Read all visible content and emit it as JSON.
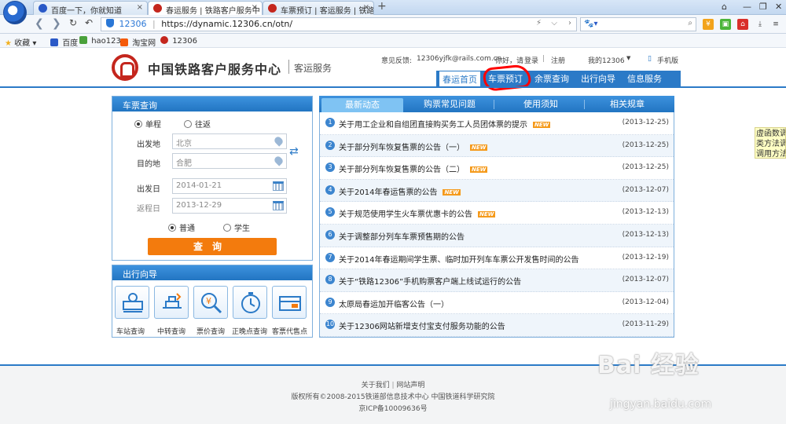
{
  "browser": {
    "tabs": [
      {
        "label": "百度一下，你就知道",
        "active": false
      },
      {
        "label": "春运服务 | 铁路客户服务中",
        "active": true
      },
      {
        "label": "车票预订 | 客运服务 | 铁路",
        "active": false
      }
    ],
    "new_tab": "+",
    "window_controls": {
      "skin": "⌂",
      "minimize": "—",
      "restore": "❐",
      "close": "✕"
    },
    "address": {
      "badge": "12306",
      "url": "https://dynamic.12306.cn/otn/"
    },
    "bookmarks": [
      {
        "label": "收藏",
        "color": "#f2b01e"
      },
      {
        "label": "百度",
        "color": "#2a59c7"
      },
      {
        "label": "hao123",
        "color": "#4aa13b"
      },
      {
        "label": "淘宝网",
        "color": "#f45a0a"
      },
      {
        "label": "12306",
        "color": "#c4261d"
      }
    ]
  },
  "header": {
    "site_name": "中国铁路客户服务中心",
    "site_sub": "客运服务",
    "feedback_label": "意见反馈:",
    "feedback_email": "12306yjfk@rails.com.cn",
    "greeting": "你好，请",
    "login": "登录",
    "register": "注册",
    "my12306": "我的12306",
    "mobile": "手机版",
    "nav": [
      "春运首页",
      "车票预订",
      "余票查询",
      "出行向导",
      "信息服务"
    ]
  },
  "ticket_query": {
    "title": "车票查询",
    "trip_types": [
      "单程",
      "往返"
    ],
    "from_label": "出发地",
    "from_value": "北京",
    "to_label": "目的地",
    "to_value": "合肥",
    "depart_label": "出发日",
    "depart_value": "2014-01-21",
    "return_label": "返程日",
    "return_value": "2013-12-29",
    "passenger_types": [
      "普通",
      "学生"
    ],
    "search_button": "查询"
  },
  "travel_guide": {
    "title": "出行向导",
    "items": [
      "车站查询",
      "中转查询",
      "票价查询",
      "正晚点查询",
      "客票代售点"
    ]
  },
  "news": {
    "tabs": [
      "最新动态",
      "购票常见问题",
      "使用须知",
      "相关规章"
    ],
    "new_badge": "NEW",
    "items": [
      {
        "num": "1",
        "title": "关于用工企业和自组团直接购买务工人员团体票的提示",
        "new": true,
        "date": "(2013-12-25)"
      },
      {
        "num": "2",
        "title": "关于部分列车恢复售票的公告（一）",
        "new": true,
        "date": "(2013-12-25)"
      },
      {
        "num": "3",
        "title": "关于部分列车恢复售票的公告（二）",
        "new": true,
        "date": "(2013-12-25)"
      },
      {
        "num": "4",
        "title": "关于2014年春运售票的公告",
        "new": true,
        "date": "(2013-12-07)"
      },
      {
        "num": "5",
        "title": "关于规范使用学生火车票优惠卡的公告",
        "new": true,
        "date": "(2013-12-13)"
      },
      {
        "num": "6",
        "title": "关于调整部分列车车票预售期的公告",
        "new": false,
        "date": "(2013-12-13)"
      },
      {
        "num": "7",
        "title": "关于2014年春运期间学生票、临时加开列车车票公开发售时间的公告",
        "new": false,
        "date": "(2013-12-19)"
      },
      {
        "num": "8",
        "title": "关于“铁路12306”手机购票客户端上线试运行的公告",
        "new": false,
        "date": "(2013-12-07)"
      },
      {
        "num": "9",
        "title": "太原局春运加开临客公告（一）",
        "new": false,
        "date": "(2013-12-04)"
      },
      {
        "num": "10",
        "title": "关于12306网站新增支付宝支付服务功能的公告",
        "new": false,
        "date": "(2013-11-29)"
      }
    ]
  },
  "footer": {
    "about": "关于我们",
    "statement": "网站声明",
    "copyright": "版权所有©2008-2015铁道部信息技术中心   中国铁道科学研究院",
    "icp": "京ICP备10009636号"
  },
  "tooltip": {
    "lines": [
      "虚函数调",
      "类方法调",
      "调用方法"
    ]
  },
  "watermark": {
    "brand": "Bai 经验",
    "url": "jingyan.baidu.com"
  }
}
